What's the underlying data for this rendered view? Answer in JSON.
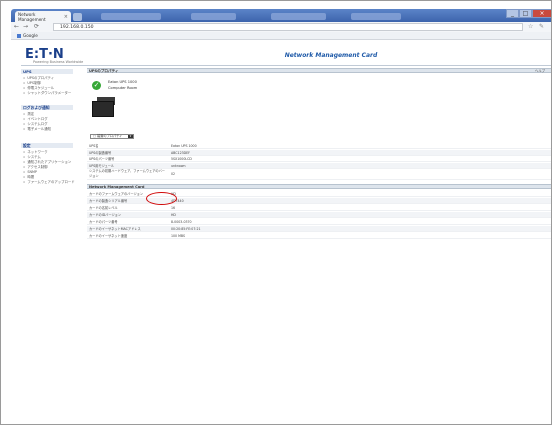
{
  "browser": {
    "tab_title": "Network Management",
    "tab_close": "×",
    "address": "192.168.0.150",
    "bookmark_label": "Google",
    "back": "←",
    "forward": "→",
    "reload": "⟳",
    "win_min": "_",
    "win_max": "□",
    "win_close": "×"
  },
  "header": {
    "logo": "E:T·N",
    "tagline": "Powering Business Worldwide",
    "title": "Network Management Card"
  },
  "sidebar": {
    "sections": [
      {
        "title": "UPS",
        "items": [
          "UPSのプロパティ",
          "UPS制御",
          "停電スケジュール",
          "シャットダウンパラメーター"
        ]
      },
      {
        "title": "ログおよび通知",
        "items": [
          "測定",
          "イベントログ",
          "システムログ",
          "電子メール通知"
        ]
      },
      {
        "title": "設定",
        "items": [
          "ネットワーク",
          "システム",
          "通知されたアプリケーション",
          "アクセス制御",
          "SNMP",
          "時間",
          "ファームウェアのアップロード"
        ]
      }
    ]
  },
  "main": {
    "section_title": "UPSのプロパティ",
    "help_label": "ヘルプ",
    "status_icon": "✓",
    "ups_model": "Eaton UPS 1000",
    "ups_location": "Computer Room",
    "dropdown_label": "▢ 装置のプロパティ",
    "dropdown_arrow": "▾",
    "ups_rows": [
      {
        "label": "UPS名",
        "value": "Eaton UPS 1000"
      },
      {
        "label": "UPSの製造番号",
        "value": "ABC123DEF"
      },
      {
        "label": "UPSのパーツ番号",
        "value": "5SX1000LCD"
      },
      {
        "label": "UPS用モジュール",
        "value": "unknown"
      },
      {
        "label": "システムの初期ハードウェア、ファームウェアのバージョン",
        "value": "02"
      }
    ],
    "nmc_section": "Network Management Card",
    "nmc_rows": [
      {
        "label": "カードのファームウェアのバージョン",
        "value": "HD"
      },
      {
        "label": "カードの製造シリアル番号",
        "value": "4D7440"
      },
      {
        "label": "カードの名前レベル",
        "value": "16"
      },
      {
        "label": "カードのIDバージョン",
        "value": "HD"
      },
      {
        "label": "カードのパーツ番号",
        "value": "8-0003-0370"
      },
      {
        "label": "カードのイーサネットMACアドレス",
        "value": "00:20:85:FE:07:21"
      },
      {
        "label": "カードのイーサネット速度",
        "value": "100 MBS"
      }
    ]
  }
}
